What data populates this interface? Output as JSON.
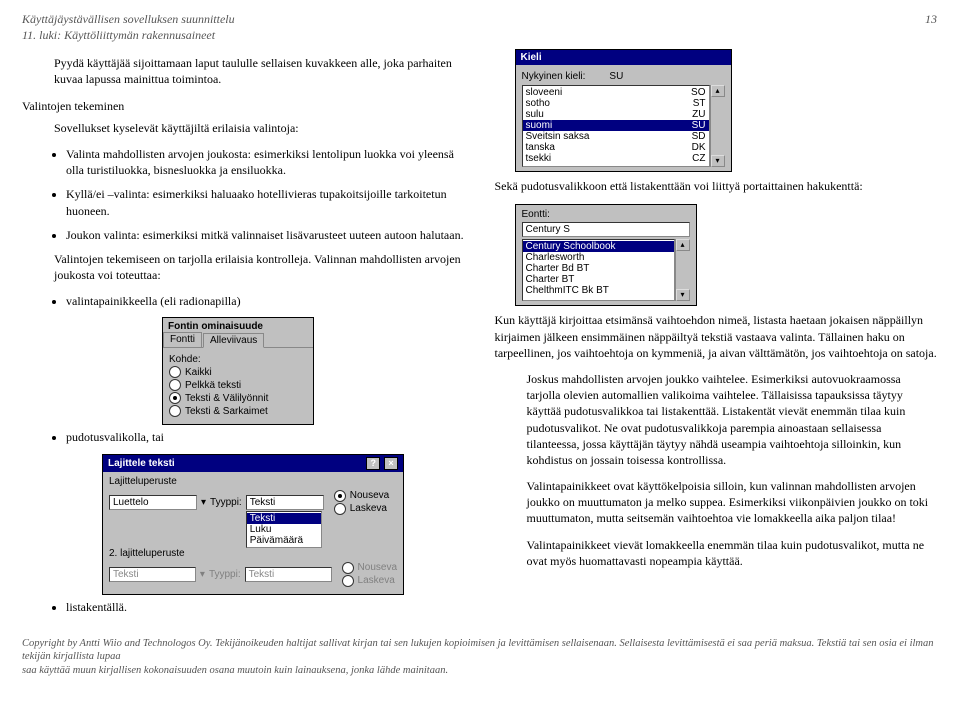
{
  "header": {
    "line1": "Käyttäjäystävällisen sovelluksen suunnittelu",
    "line2": "11. luki: Käyttöliittymän rakennusaineet",
    "page": "13"
  },
  "left": {
    "intro": "Pyydä käyttäjää sijoittamaan laput taululle sellaisen kuvakkeen alle, joka parhaiten kuvaa lapussa mainittua toimintoa.",
    "heading1": "Valintojen tekeminen",
    "p1": "Sovellukset kyselevät käyttäjiltä erilaisia valintoja:",
    "bullets1": [
      "Valinta mahdollisten arvojen joukosta: esimerkiksi lentolipun luokka voi yleensä olla turistiluokka, bisnesluokka ja ensiluokka.",
      "Kyllä/ei –valinta: esimerkiksi haluaako hotellivieras tupakoitsijoille tarkoitetun huoneen.",
      "Joukon valinta: esimerkiksi mitkä valinnaiset lisävarusteet uuteen autoon halutaan."
    ],
    "p2": "Valintojen tekemiseen on tarjolla erilaisia kontrolleja. Valinnan mahdollisten arvojen joukosta voi toteuttaa:",
    "bullets2": [
      "valintapainikkeella (eli radionapilla)",
      "pudotusvalikolla, tai",
      "listakentällä."
    ]
  },
  "ui_fontprops": {
    "title": "Fontin ominaisuude",
    "tab1": "Fontti",
    "tab2": "Alleviivaus",
    "groupLabel": "Kohde:",
    "radios": [
      "Kaikki",
      "Pelkkä teksti",
      "Teksti & Välilyönnit",
      "Teksti & Sarkaimet"
    ],
    "selected": 2
  },
  "ui_sort": {
    "title": "Lajittele teksti",
    "l1": "Lajitteluperuste",
    "l2": "2. lajitteluperuste",
    "typeLabel": "Tyyppi:",
    "field1": "Luettelo",
    "field2": "Teksti",
    "typeSel": "Teksti",
    "typeOptions": [
      "Teksti",
      "Luku",
      "Päivämäärä"
    ],
    "disabledType": "Teksti",
    "orderAsc": "Nouseva",
    "orderDesc": "Laskeva"
  },
  "right": {
    "intro": "Sekä pudotusvalikkoon että listakenttään voi liittyä portaittainen hakukenttä:",
    "p1": "Kun käyttäjä kirjoittaa etsimänsä vaihtoehdon nimeä, listasta haetaan jokaisen näppäillyn kirjaimen jälkeen ensimmäinen näppäiltyä tekstiä vastaava valinta. Tällainen haku on tarpeellinen, jos vaihtoehtoja on kymmeniä, ja aivan välttämätön, jos vaihtoehtoja on satoja.",
    "p2": "Joskus mahdollisten arvojen joukko vaihtelee. Esimerkiksi autovuokraamossa tarjolla olevien automallien valikoima vaihtelee. Tällaisissa tapauksissa täytyy käyttää pudotusvalikkoa tai listakenttää. Listakentät vievät enemmän tilaa kuin pudotusvalikot. Ne ovat pudotusvalikkoja parempia ainoastaan sellaisessa tilanteessa, jossa käyttäjän täytyy nähdä useampia vaihtoehtoja silloinkin, kun kohdistus on jossain toisessa kontrollissa.",
    "p3": "Valintapainikkeet ovat käyttökelpoisia silloin, kun valinnan mahdollisten arvojen joukko on muuttumaton ja melko suppea. Esimerkiksi viikonpäivien joukko on toki muuttumaton, mutta seitsemän vaihtoehtoa vie lomakkeella aika paljon tilaa!",
    "p4": "Valintapainikkeet vievät lomakkeella enemmän tilaa kuin pudotusvalikot, mutta ne ovat myös huomattavasti nopeampia käyttää."
  },
  "ui_lang": {
    "title": "Kieli",
    "currentLabel": "Nykyinen kieli:",
    "current": "SU",
    "items": [
      [
        "sloveeni",
        "SO"
      ],
      [
        "sotho",
        "ST"
      ],
      [
        "sulu",
        "ZU"
      ],
      [
        "suomi",
        "SU"
      ],
      [
        "Sveitsin saksa",
        "SD"
      ],
      [
        "tanska",
        "DK"
      ],
      [
        "tsekki",
        "CZ"
      ]
    ],
    "selectedIndex": 3
  },
  "ui_font": {
    "label": "Eontti:",
    "input": "Century S",
    "options": [
      "Century Schoolbook",
      "Charlesworth",
      "Charter Bd BT",
      "Charter BT",
      "ChelthmITC Bk BT"
    ]
  },
  "footer": {
    "l1": "Copyright by Antti Wiio and Technologos Oy.   Tekijänoikeuden haltijat sallivat kirjan tai sen lukujen kopioimisen ja levittämisen sellaisenaan.  Sellaisesta levittämisestä ei saa periä maksua.  Tekstiä tai sen osia ei ilman tekijän kirjallista lupaa",
    "l2": "saa käyttää muun kirjallisen kokonaisuuden osana muutoin kuin lainauksena, jonka lähde mainitaan."
  }
}
